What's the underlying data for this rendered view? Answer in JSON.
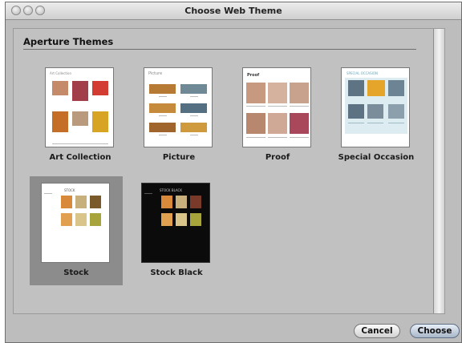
{
  "window": {
    "title": "Choose Web Theme"
  },
  "section": {
    "heading": "Aperture Themes"
  },
  "themes": [
    {
      "label": "Art Collection",
      "preview_title": "Art Collection"
    },
    {
      "label": "Picture",
      "preview_title": "Picture"
    },
    {
      "label": "Proof",
      "preview_title": "Proof"
    },
    {
      "label": "Special Occasion",
      "preview_title": "SPECIAL OCCASION"
    },
    {
      "label": "Stock",
      "preview_title": "STOCK",
      "selected": true
    },
    {
      "label": "Stock Black",
      "preview_title": "STOCK BLACK"
    }
  ],
  "buttons": {
    "cancel": "Cancel",
    "choose": "Choose"
  }
}
